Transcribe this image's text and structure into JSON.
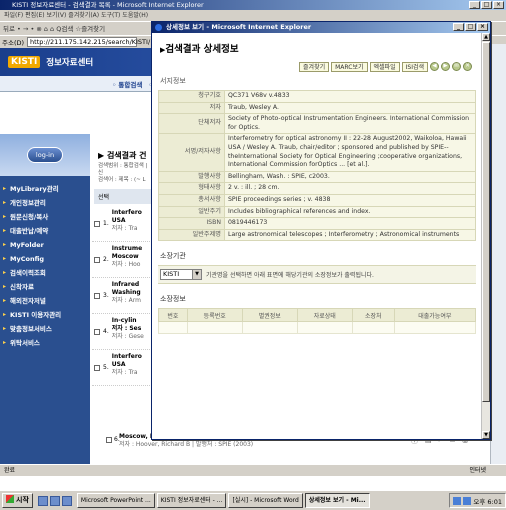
{
  "background": {
    "title": "KISTI 정보자료센터 - 검색결과 목록 - Microsoft Internet Explorer",
    "menu": "파일(F)  편집(E)  보기(V)  즐겨찾기(A)  도구(T)  도움말(H)",
    "toolbar": "뒤로 • → • ⊗ ⌂ ⌂ Q검색 ☆즐겨찾기",
    "address_label": "주소(D)",
    "address_value": "http://211.175.142.215/search/KISTI/",
    "logo": "KISTI",
    "site_title": "정보자료센터",
    "subnav": [
      "◦ 통합검색",
      "◦ 도"
    ],
    "login_label": "log-in",
    "sidebar_items": [
      "MyLibrary관리",
      "개인정보관리",
      "원문신청/복사",
      "대출반납/예약",
      "MyFolder",
      "MyConfig",
      "검색이력조회",
      "신착자료",
      "해외전자저널",
      "KISTI 이용자관리",
      "맞춤정보서비스",
      "위탁서비스"
    ],
    "results_title": "▶ 검색결과 건",
    "results_meta1": "검색범위 : 통합검색 | 신",
    "results_meta2": "검색어 : 제목 : (~ L",
    "results_select": "선택",
    "results": [
      {
        "num": "1.",
        "line1": "Interfero",
        "line2": "USA",
        "line3": "저자 : Tra"
      },
      {
        "num": "2.",
        "line1": "Instrume",
        "line2": "Moscow",
        "line3": "저자 : Hoo"
      },
      {
        "num": "3.",
        "line1": "Infrared",
        "line2": "Washing",
        "line3": "저자 : Arm"
      },
      {
        "num": "4.",
        "line1": "In-cylin",
        "line2": "저자 : Ses",
        "line3": "저자 : Gese"
      },
      {
        "num": "5.",
        "line1": "Interfero",
        "line2": "USA",
        "line3": "저자 : Tra"
      }
    ],
    "bottom_item": {
      "num": "6.",
      "title": "Moscow, Russia",
      "authors": "저자 : Hoover, Richard B | 발행처 : SPIE (2003)"
    },
    "status_left": "완료",
    "status_zone": "인터넷"
  },
  "popup": {
    "title": "상세정보 보기 - Microsoft Internet Explorer",
    "heading": "검색결과 상세정보",
    "buttons": [
      "즐겨찾기",
      "MARC보기",
      "엑셀파일",
      "ISI검색"
    ],
    "nav_circles": [
      "◀",
      "▶",
      "✉",
      "✕"
    ],
    "section_bib": "서지정보",
    "rows": [
      {
        "label": "청구기호",
        "value": "QC371 V68v v.4833"
      },
      {
        "label": "저자",
        "value": "Traub, Wesley A."
      },
      {
        "label": "단체저자",
        "value": "Society of Photo-optical Instrumentation Engineers. International Commission for Optics."
      },
      {
        "label": "서명/저자사항",
        "value": "Interferometry for optical astronomy II : 22-28 August2002, Waikoloa, Hawaii USA / Wesley A. Traub, chair/editor ; sponsored and published by SPIE--theInternational Society for Optical Engineering ;cooperative organizations, International Commission forOptics ... [et al.]."
      },
      {
        "label": "발행사항",
        "value": "Bellingham, Wash. : SPIE, c2003."
      },
      {
        "label": "형태사항",
        "value": "2 v. : ill. ; 28 cm."
      },
      {
        "label": "총서사항",
        "value": "SPIE proceedings series ; v. 4838"
      },
      {
        "label": "일반주기",
        "value": "Includes bibliographical references and index."
      },
      {
        "label": "ISBN",
        "value": "0819446173"
      },
      {
        "label": "일반주제명",
        "value": "Large astronomical telescopes ; Interferometry ; Astronomical instruments"
      }
    ],
    "holding_label": "소장기관",
    "holding_select": "KISTI",
    "holding_note": "기관명을 선택하면 아래 표면에 해당기관의 소장정보가 출력됩니다.",
    "location_label": "소장정보",
    "location_headers": [
      "번호",
      "등록번호",
      "별권정보",
      "자료상태",
      "소장처",
      "대출가능여부"
    ]
  },
  "taskbar": {
    "start": "시작",
    "tasks": [
      "Microsoft PowerPoint ...",
      "KISTI 정보자료센터 - ...",
      "[실시] - Microsoft Word",
      "상세정보 보기 - Mi..."
    ],
    "clock": "오후 6:01"
  }
}
